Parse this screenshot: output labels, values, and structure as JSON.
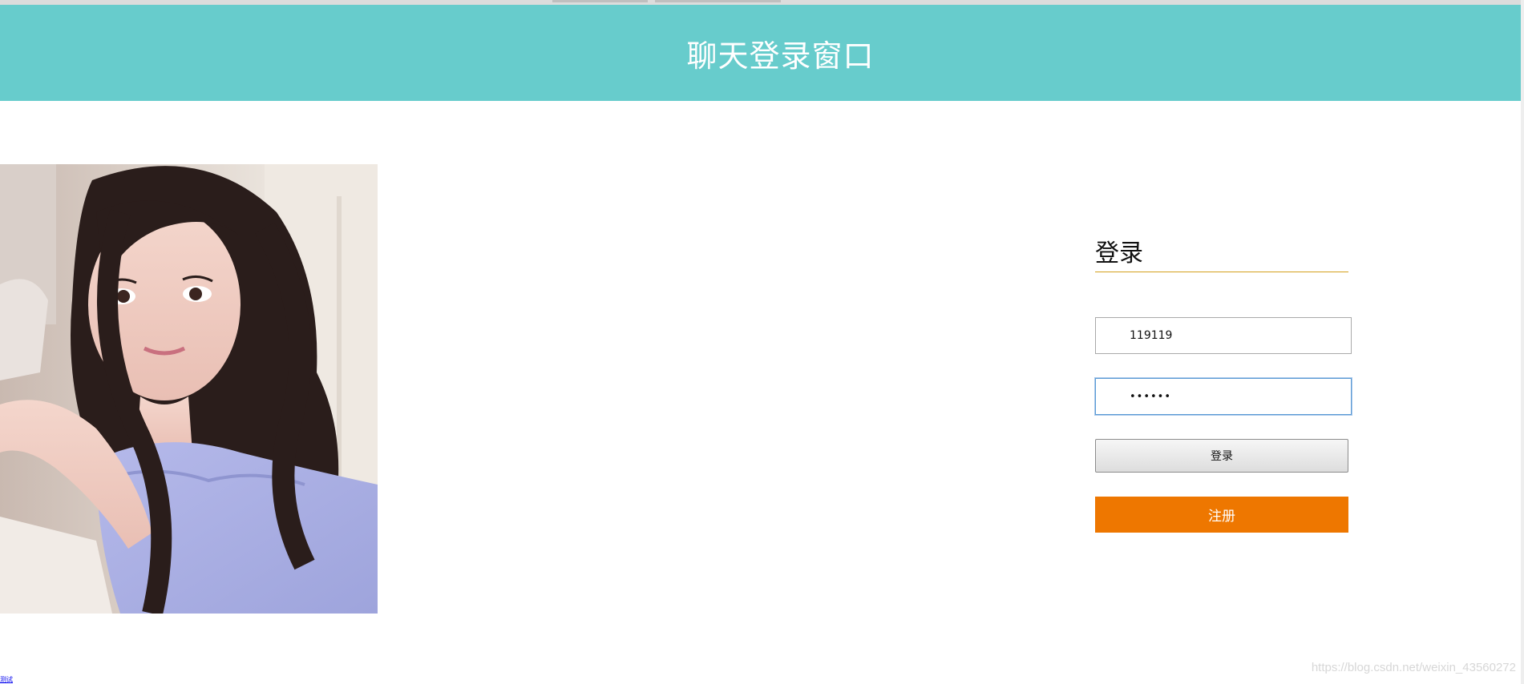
{
  "header": {
    "title": "聊天登录窗口"
  },
  "photo": {
    "alt": "portrait photo"
  },
  "login": {
    "heading": "登录",
    "username_value": "119119",
    "password_mask": "••••••",
    "login_button": "登录",
    "register_button": "注册"
  },
  "footer": {
    "watermark": "https://blog.csdn.net/weixin_43560272",
    "corner_link": "测试"
  },
  "colors": {
    "header_bg": "#67cccc",
    "register_bg": "#ee7700",
    "heading_underline": "#d4a01c"
  }
}
